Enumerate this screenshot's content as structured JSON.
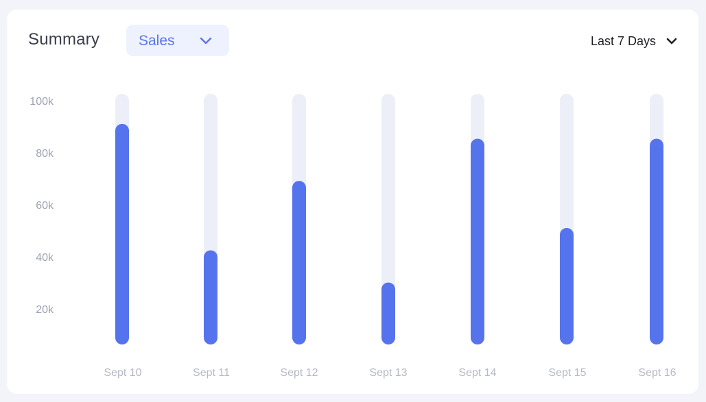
{
  "header": {
    "title": "Summary",
    "metric_selected": "Sales",
    "range_selected": "Last 7 Days"
  },
  "icons": {
    "metric_dropdown": "chevron-down-icon",
    "range_dropdown": "chevron-down-icon"
  },
  "colors": {
    "bar": "#5673ee",
    "track": "#eceff8",
    "accent": "#5a74e8"
  },
  "chart_data": {
    "type": "bar",
    "title": "",
    "xlabel": "",
    "ylabel": "",
    "categories": [
      "Sept 10",
      "Sept 11",
      "Sept 12",
      "Sept 13",
      "Sept 14",
      "Sept 15",
      "Sept 16"
    ],
    "values": [
      89000,
      38000,
      66000,
      25000,
      83000,
      47000,
      83000
    ],
    "y_ticks": [
      "20k",
      "40k",
      "60k",
      "80k",
      "100k"
    ],
    "y_tick_values": [
      20000,
      40000,
      60000,
      80000,
      100000
    ],
    "ylim": [
      0,
      100000
    ],
    "grid": false,
    "legend": "none"
  }
}
